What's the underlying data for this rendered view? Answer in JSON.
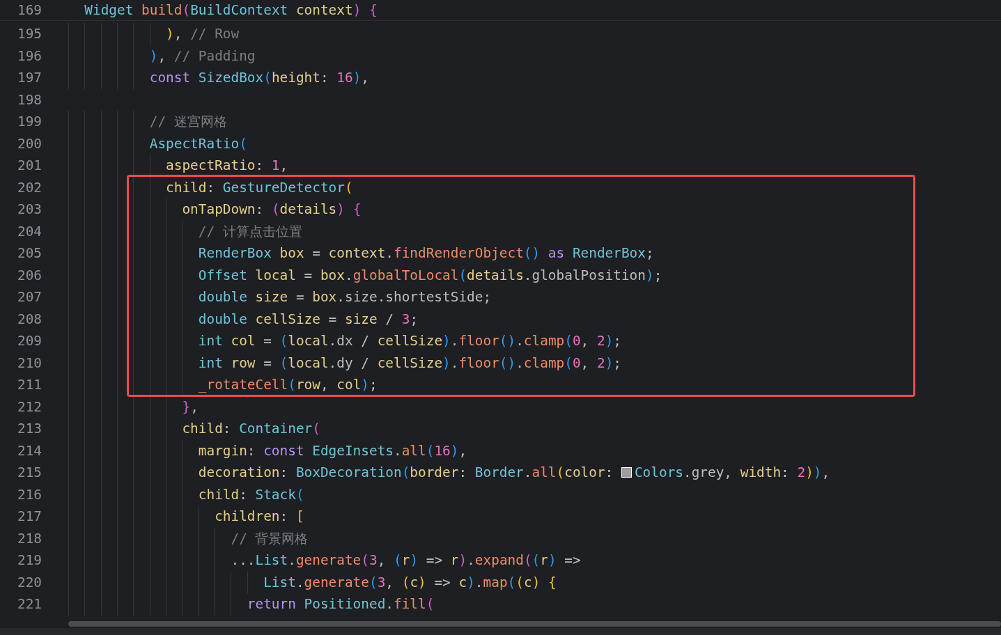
{
  "sticky_header": {
    "number": "169",
    "tokens": [
      {
        "text": "  Widget ",
        "kind": "cls"
      },
      {
        "text": "build",
        "kind": "fn"
      },
      {
        "text": "(",
        "kind": "b2"
      },
      {
        "text": "BuildContext ",
        "kind": "cls"
      },
      {
        "text": "context",
        "kind": "var"
      },
      {
        "text": ")",
        "kind": "b2"
      },
      {
        "text": " {",
        "kind": "b2"
      }
    ]
  },
  "lines": [
    {
      "number": "195",
      "tokens": [
        {
          "text": "            )",
          "kind": "b1"
        },
        {
          "text": ", ",
          "kind": "plain"
        },
        {
          "text": "// Row",
          "kind": "cmt"
        }
      ]
    },
    {
      "number": "196",
      "tokens": [
        {
          "text": "          )",
          "kind": "b3"
        },
        {
          "text": ", ",
          "kind": "plain"
        },
        {
          "text": "// Padding",
          "kind": "cmt"
        }
      ]
    },
    {
      "number": "197",
      "tokens": [
        {
          "text": "          const ",
          "kind": "kw"
        },
        {
          "text": "SizedBox",
          "kind": "cls"
        },
        {
          "text": "(",
          "kind": "b3"
        },
        {
          "text": "height",
          "kind": "var"
        },
        {
          "text": ": ",
          "kind": "plain"
        },
        {
          "text": "16",
          "kind": "num"
        },
        {
          "text": ")",
          "kind": "b3"
        },
        {
          "text": ",",
          "kind": "plain"
        }
      ]
    },
    {
      "number": "198"
    },
    {
      "number": "199",
      "tokens": [
        {
          "text": "          // 迷宫网格",
          "kind": "cmt"
        }
      ]
    },
    {
      "number": "200",
      "tokens": [
        {
          "text": "          AspectRatio",
          "kind": "cls"
        },
        {
          "text": "(",
          "kind": "b3"
        }
      ]
    },
    {
      "number": "201",
      "tokens": [
        {
          "text": "            aspectRatio",
          "kind": "var"
        },
        {
          "text": ": ",
          "kind": "plain"
        },
        {
          "text": "1",
          "kind": "num"
        },
        {
          "text": ",",
          "kind": "plain"
        }
      ]
    },
    {
      "number": "202",
      "tokens": [
        {
          "text": "            child",
          "kind": "var"
        },
        {
          "text": ": ",
          "kind": "plain"
        },
        {
          "text": "GestureDetector",
          "kind": "cls"
        },
        {
          "text": "(",
          "kind": "b1"
        }
      ]
    },
    {
      "number": "203",
      "tokens": [
        {
          "text": "              onTapDown",
          "kind": "var"
        },
        {
          "text": ": ",
          "kind": "plain"
        },
        {
          "text": "(",
          "kind": "b2"
        },
        {
          "text": "details",
          "kind": "var"
        },
        {
          "text": ") {",
          "kind": "b2"
        }
      ]
    },
    {
      "number": "204",
      "tokens": [
        {
          "text": "                // 计算点击位置",
          "kind": "cmt"
        }
      ]
    },
    {
      "number": "205",
      "tokens": [
        {
          "text": "                RenderBox ",
          "kind": "cls"
        },
        {
          "text": "box",
          "kind": "var"
        },
        {
          "text": " = ",
          "kind": "plain"
        },
        {
          "text": "context",
          "kind": "var"
        },
        {
          "text": ".",
          "kind": "plain"
        },
        {
          "text": "findRenderObject",
          "kind": "fn"
        },
        {
          "text": "() ",
          "kind": "b3"
        },
        {
          "text": "as ",
          "kind": "kw"
        },
        {
          "text": "RenderBox",
          "kind": "cls"
        },
        {
          "text": ";",
          "kind": "plain"
        }
      ]
    },
    {
      "number": "206",
      "tokens": [
        {
          "text": "                Offset ",
          "kind": "cls"
        },
        {
          "text": "local",
          "kind": "var"
        },
        {
          "text": " = ",
          "kind": "plain"
        },
        {
          "text": "box",
          "kind": "var"
        },
        {
          "text": ".",
          "kind": "plain"
        },
        {
          "text": "globalToLocal",
          "kind": "fn"
        },
        {
          "text": "(",
          "kind": "b3"
        },
        {
          "text": "details",
          "kind": "var"
        },
        {
          "text": ".globalPosition",
          "kind": "plain"
        },
        {
          "text": ")",
          "kind": "b3"
        },
        {
          "text": ";",
          "kind": "plain"
        }
      ]
    },
    {
      "number": "207",
      "tokens": [
        {
          "text": "                double ",
          "kind": "cls"
        },
        {
          "text": "size",
          "kind": "var"
        },
        {
          "text": " = ",
          "kind": "plain"
        },
        {
          "text": "box",
          "kind": "var"
        },
        {
          "text": ".size.shortestSide;",
          "kind": "plain"
        }
      ]
    },
    {
      "number": "208",
      "tokens": [
        {
          "text": "                double ",
          "kind": "cls"
        },
        {
          "text": "cellSize",
          "kind": "var"
        },
        {
          "text": " = ",
          "kind": "plain"
        },
        {
          "text": "size",
          "kind": "var"
        },
        {
          "text": " / ",
          "kind": "plain"
        },
        {
          "text": "3",
          "kind": "num"
        },
        {
          "text": ";",
          "kind": "plain"
        }
      ]
    },
    {
      "number": "209",
      "tokens": [
        {
          "text": "                int ",
          "kind": "cls"
        },
        {
          "text": "col",
          "kind": "var"
        },
        {
          "text": " = ",
          "kind": "plain"
        },
        {
          "text": "(",
          "kind": "b3"
        },
        {
          "text": "local",
          "kind": "var"
        },
        {
          "text": ".dx / ",
          "kind": "plain"
        },
        {
          "text": "cellSize",
          "kind": "var"
        },
        {
          "text": ")",
          "kind": "b3"
        },
        {
          "text": ".",
          "kind": "plain"
        },
        {
          "text": "floor",
          "kind": "fn"
        },
        {
          "text": "()",
          "kind": "b3"
        },
        {
          "text": ".",
          "kind": "plain"
        },
        {
          "text": "clamp",
          "kind": "fn"
        },
        {
          "text": "(",
          "kind": "b3"
        },
        {
          "text": "0",
          "kind": "num"
        },
        {
          "text": ", ",
          "kind": "plain"
        },
        {
          "text": "2",
          "kind": "num"
        },
        {
          "text": ")",
          "kind": "b3"
        },
        {
          "text": ";",
          "kind": "plain"
        }
      ]
    },
    {
      "number": "210",
      "tokens": [
        {
          "text": "                int ",
          "kind": "cls"
        },
        {
          "text": "row",
          "kind": "var"
        },
        {
          "text": " = ",
          "kind": "plain"
        },
        {
          "text": "(",
          "kind": "b3"
        },
        {
          "text": "local",
          "kind": "var"
        },
        {
          "text": ".dy / ",
          "kind": "plain"
        },
        {
          "text": "cellSize",
          "kind": "var"
        },
        {
          "text": ")",
          "kind": "b3"
        },
        {
          "text": ".",
          "kind": "plain"
        },
        {
          "text": "floor",
          "kind": "fn"
        },
        {
          "text": "()",
          "kind": "b3"
        },
        {
          "text": ".",
          "kind": "plain"
        },
        {
          "text": "clamp",
          "kind": "fn"
        },
        {
          "text": "(",
          "kind": "b3"
        },
        {
          "text": "0",
          "kind": "num"
        },
        {
          "text": ", ",
          "kind": "plain"
        },
        {
          "text": "2",
          "kind": "num"
        },
        {
          "text": ")",
          "kind": "b3"
        },
        {
          "text": ";",
          "kind": "plain"
        }
      ]
    },
    {
      "number": "211",
      "tokens": [
        {
          "text": "                _rotateCell",
          "kind": "fn"
        },
        {
          "text": "(",
          "kind": "b3"
        },
        {
          "text": "row",
          "kind": "var"
        },
        {
          "text": ", ",
          "kind": "plain"
        },
        {
          "text": "col",
          "kind": "var"
        },
        {
          "text": ")",
          "kind": "b3"
        },
        {
          "text": ";",
          "kind": "plain"
        }
      ]
    },
    {
      "number": "212",
      "tokens": [
        {
          "text": "              }",
          "kind": "b2"
        },
        {
          "text": ",",
          "kind": "plain"
        }
      ]
    },
    {
      "number": "213",
      "tokens": [
        {
          "text": "              child",
          "kind": "var"
        },
        {
          "text": ": ",
          "kind": "plain"
        },
        {
          "text": "Container",
          "kind": "cls"
        },
        {
          "text": "(",
          "kind": "b2"
        }
      ]
    },
    {
      "number": "214",
      "tokens": [
        {
          "text": "                margin",
          "kind": "var"
        },
        {
          "text": ": ",
          "kind": "plain"
        },
        {
          "text": "const ",
          "kind": "kw"
        },
        {
          "text": "EdgeInsets",
          "kind": "cls"
        },
        {
          "text": ".",
          "kind": "plain"
        },
        {
          "text": "all",
          "kind": "fn"
        },
        {
          "text": "(",
          "kind": "b3"
        },
        {
          "text": "16",
          "kind": "num"
        },
        {
          "text": ")",
          "kind": "b3"
        },
        {
          "text": ",",
          "kind": "plain"
        }
      ]
    },
    {
      "number": "215",
      "tokens": [
        {
          "text": "                decoration",
          "kind": "var"
        },
        {
          "text": ": ",
          "kind": "plain"
        },
        {
          "text": "BoxDecoration",
          "kind": "cls"
        },
        {
          "text": "(",
          "kind": "b3"
        },
        {
          "text": "border",
          "kind": "var"
        },
        {
          "text": ": ",
          "kind": "plain"
        },
        {
          "text": "Border",
          "kind": "cls"
        },
        {
          "text": ".",
          "kind": "plain"
        },
        {
          "text": "all",
          "kind": "fn"
        },
        {
          "text": "(",
          "kind": "b1"
        },
        {
          "text": "color",
          "kind": "var"
        },
        {
          "text": ": ",
          "kind": "plain"
        },
        {
          "kind": "swatch"
        },
        {
          "text": "Colors",
          "kind": "cls"
        },
        {
          "text": ".grey, ",
          "kind": "plain"
        },
        {
          "text": "width",
          "kind": "var"
        },
        {
          "text": ": ",
          "kind": "plain"
        },
        {
          "text": "2",
          "kind": "num"
        },
        {
          "text": ")",
          "kind": "b1"
        },
        {
          "text": ")",
          "kind": "b3"
        },
        {
          "text": ",",
          "kind": "plain"
        }
      ]
    },
    {
      "number": "216",
      "tokens": [
        {
          "text": "                child",
          "kind": "var"
        },
        {
          "text": ": ",
          "kind": "plain"
        },
        {
          "text": "Stack",
          "kind": "cls"
        },
        {
          "text": "(",
          "kind": "b3"
        }
      ]
    },
    {
      "number": "217",
      "tokens": [
        {
          "text": "                  children",
          "kind": "var"
        },
        {
          "text": ": ",
          "kind": "plain"
        },
        {
          "text": "[",
          "kind": "b1"
        }
      ]
    },
    {
      "number": "218",
      "tokens": [
        {
          "text": "                    // 背景网格",
          "kind": "cmt"
        }
      ]
    },
    {
      "number": "219",
      "tokens": [
        {
          "text": "                    ...",
          "kind": "plain"
        },
        {
          "text": "List",
          "kind": "cls"
        },
        {
          "text": ".",
          "kind": "plain"
        },
        {
          "text": "generate",
          "kind": "fn"
        },
        {
          "text": "(",
          "kind": "b2"
        },
        {
          "text": "3",
          "kind": "num"
        },
        {
          "text": ", ",
          "kind": "plain"
        },
        {
          "text": "(",
          "kind": "b3"
        },
        {
          "text": "r",
          "kind": "var"
        },
        {
          "text": ")",
          "kind": "b3"
        },
        {
          "text": " => ",
          "kind": "plain"
        },
        {
          "text": "r",
          "kind": "var"
        },
        {
          "text": ")",
          "kind": "b2"
        },
        {
          "text": ".",
          "kind": "plain"
        },
        {
          "text": "expand",
          "kind": "fn"
        },
        {
          "text": "(",
          "kind": "b2"
        },
        {
          "text": "(",
          "kind": "b3"
        },
        {
          "text": "r",
          "kind": "var"
        },
        {
          "text": ")",
          "kind": "b3"
        },
        {
          "text": " =>",
          "kind": "plain"
        }
      ]
    },
    {
      "number": "220",
      "tokens": [
        {
          "text": "                        List",
          "kind": "cls"
        },
        {
          "text": ".",
          "kind": "plain"
        },
        {
          "text": "generate",
          "kind": "fn"
        },
        {
          "text": "(",
          "kind": "b3"
        },
        {
          "text": "3",
          "kind": "num"
        },
        {
          "text": ", ",
          "kind": "plain"
        },
        {
          "text": "(",
          "kind": "b1"
        },
        {
          "text": "c",
          "kind": "var"
        },
        {
          "text": ")",
          "kind": "b1"
        },
        {
          "text": " => ",
          "kind": "plain"
        },
        {
          "text": "c",
          "kind": "var"
        },
        {
          "text": ")",
          "kind": "b3"
        },
        {
          "text": ".",
          "kind": "plain"
        },
        {
          "text": "map",
          "kind": "fn"
        },
        {
          "text": "(",
          "kind": "b3"
        },
        {
          "text": "(",
          "kind": "b1"
        },
        {
          "text": "c",
          "kind": "var"
        },
        {
          "text": ") {",
          "kind": "b1"
        }
      ]
    },
    {
      "number": "221",
      "tokens": [
        {
          "text": "                      return ",
          "kind": "kw"
        },
        {
          "text": "Positioned",
          "kind": "cls"
        },
        {
          "text": ".",
          "kind": "plain"
        },
        {
          "text": "fill",
          "kind": "fn"
        },
        {
          "text": "(",
          "kind": "b2"
        }
      ]
    }
  ]
}
